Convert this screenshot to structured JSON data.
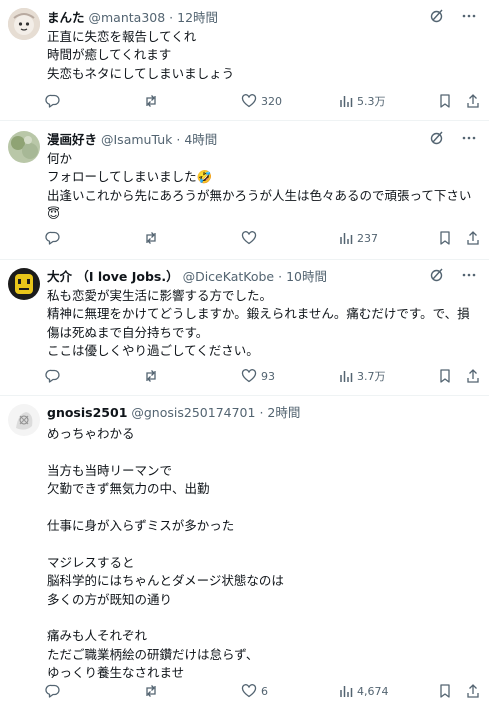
{
  "tweets": [
    {
      "name": "まんた",
      "handle": "@manta308",
      "dot": "·",
      "time": "12時間",
      "lines": [
        "正直に失恋を報告してくれ",
        "時間が癒してくれます",
        "失恋もネタにしてしまいましょう"
      ],
      "replies": "",
      "retweets": "",
      "likes": "320",
      "views": "5.3万"
    },
    {
      "name": "漫画好き",
      "handle": "@IsamuTuk",
      "dot": "·",
      "time": "4時間",
      "lines": [
        "何か",
        "フォローしてしまいました🤣",
        "出逢いこれから先にあろうが無かろうが人生は色々あるので頑張って下さい",
        "😇"
      ],
      "replies": "",
      "retweets": "",
      "likes": "",
      "views": "237"
    },
    {
      "name": "大介 （I love Jobs.）",
      "handle": "@DiceKatKobe",
      "dot": "·",
      "time": "10時間",
      "lines": [
        "私も恋愛が実生活に影響する方でした。",
        "精神に無理をかけてどうしますか。鍛えられません。痛むだけです。で、損",
        "傷は死ぬまで自分持ちです。",
        "ここは優しくやり過ごしてください。"
      ],
      "replies": "",
      "retweets": "",
      "likes": "93",
      "views": "3.7万"
    },
    {
      "name": "gnosis2501",
      "handle": "@gnosis250174701",
      "dot": "·",
      "time": "2時間",
      "lines": [
        "めっちゃわかる",
        "",
        "当方も当時リーマンで",
        "欠勤できず無気力の中、出勤",
        "",
        "仕事に身が入らずミスが多かった",
        "",
        "マジレスすると",
        "脳科学的にはちゃんとダメージ状態なのは",
        "多くの方が既知の通り",
        "",
        "痛みも人それぞれ",
        "ただご職業柄絵の研鑽だけは怠らず、",
        "ゆっくり養生なされませ"
      ],
      "replies": "",
      "retweets": "",
      "likes": "6",
      "views": "4,674"
    }
  ],
  "icons": {
    "reply": "reply-icon",
    "retweet": "retweet-icon",
    "like": "heart-icon",
    "views": "views-icon",
    "bookmark": "bookmark-icon",
    "share": "share-icon",
    "grok": "grok-icon",
    "more": "more-icon"
  },
  "colors": {
    "text": "#0f1419",
    "secondary": "#536471",
    "divider": "#eff3f4"
  }
}
